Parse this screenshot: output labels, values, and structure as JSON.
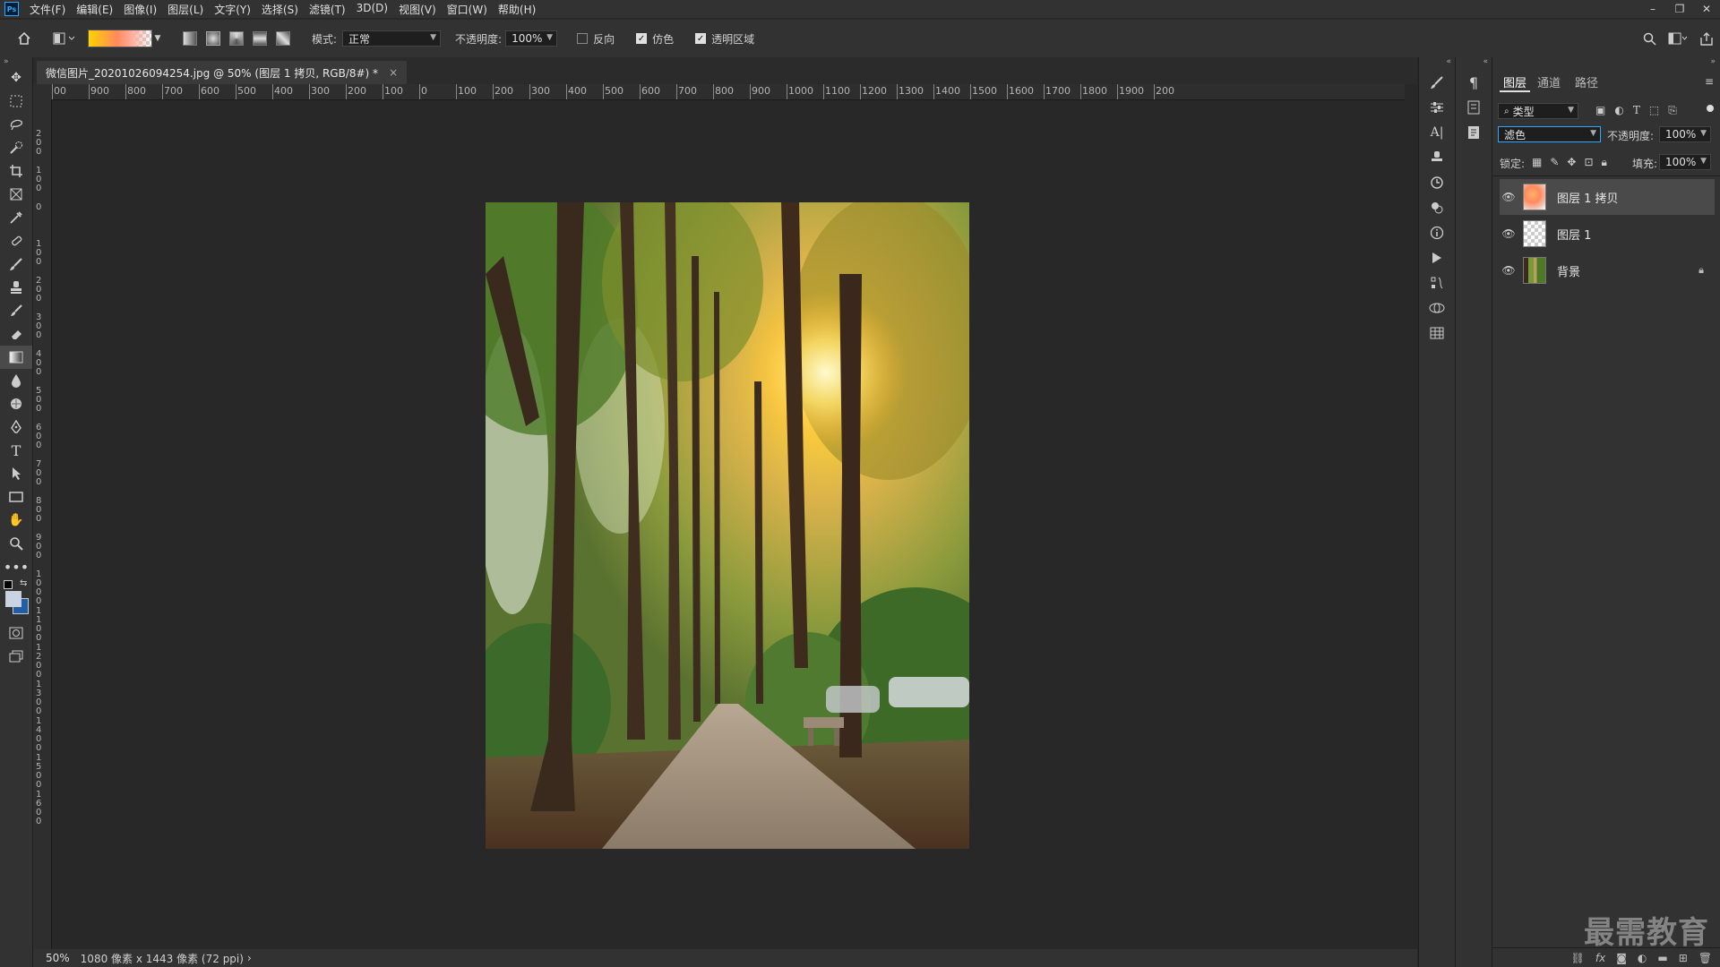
{
  "app": {
    "logo": "Ps"
  },
  "menu": [
    "文件(F)",
    "编辑(E)",
    "图像(I)",
    "图层(L)",
    "文字(Y)",
    "选择(S)",
    "滤镜(T)",
    "3D(D)",
    "视图(V)",
    "窗口(W)",
    "帮助(H)"
  ],
  "window_controls": {
    "minimize": "–",
    "restore": "❐",
    "close": "✕"
  },
  "options": {
    "mode_label": "模式:",
    "mode_value": "正常",
    "opacity_label": "不透明度:",
    "opacity_value": "100%",
    "reverse_label": "反向",
    "reverse_checked": false,
    "dither_label": "仿色",
    "dither_checked": true,
    "transparency_label": "透明区域",
    "transparency_checked": true
  },
  "document": {
    "tab_title": "微信图片_20201026094254.jpg @ 50% (图层 1 拷贝, RGB/8#) *",
    "close": "×"
  },
  "ruler": {
    "h_labels": [
      "00",
      "900",
      "800",
      "700",
      "600",
      "500",
      "400",
      "300",
      "200",
      "100",
      "0",
      "100",
      "200",
      "300",
      "400",
      "500",
      "600",
      "700",
      "800",
      "900",
      "1000",
      "1100",
      "1200",
      "1300",
      "1400",
      "1500",
      "1600",
      "1700",
      "1800",
      "1900",
      "200"
    ],
    "v_labels": [
      "200",
      "100",
      "0",
      "100",
      "200",
      "300",
      "400",
      "500",
      "600",
      "700",
      "800",
      "900",
      "1000",
      "1100",
      "1200",
      "1300",
      "1400",
      "1500",
      "1600"
    ]
  },
  "status": {
    "zoom": "50%",
    "info": "1080 像素 x 1443 像素 (72 ppi)",
    "arrow": "›"
  },
  "layers_panel": {
    "tabs": [
      "图层",
      "通道",
      "路径"
    ],
    "filter_label": "类型",
    "blend_mode": "滤色",
    "opacity_label": "不透明度:",
    "opacity_value": "100%",
    "lock_label": "锁定:",
    "fill_label": "填充:",
    "fill_value": "100%",
    "layers": [
      {
        "name": "图层 1 拷贝",
        "selected": true
      },
      {
        "name": "图层 1",
        "selected": false
      },
      {
        "name": "背景",
        "selected": false,
        "locked": true
      }
    ]
  },
  "watermark": "最需教育",
  "colors": {
    "accent": "#31a8ff",
    "panel_bg": "#323232",
    "canvas_bg": "#282828"
  }
}
